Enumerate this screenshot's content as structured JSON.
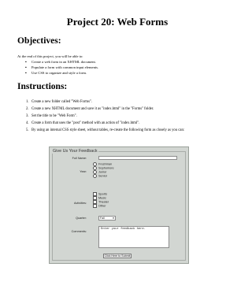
{
  "title": "Project 20: Web Forms",
  "objectives": {
    "heading": "Objectives:",
    "intro": "At the end of this project, you will be able to:",
    "items": [
      "Create a web form in an XHTML document.",
      "Populate a form with common input elements.",
      "Use CSS to organize and style a form."
    ]
  },
  "instructions": {
    "heading": "Instructions:",
    "steps": [
      {
        "num": "1.",
        "text": "Create a new folder called \"Web Forms\"."
      },
      {
        "num": "2.",
        "text": "Create a new XHTML document and save it as \"index.html\" in the \"Forms\" folder."
      },
      {
        "num": "3.",
        "text": "Set the title to be \"Web Form\"."
      },
      {
        "num": "4.",
        "text": "Create a form that uses the \"post\" method with an action of \"index.html\"."
      },
      {
        "num": "5.",
        "text": "By using an internal CSS style sheet, without tables, re-create the following form as closely as you can:"
      }
    ]
  },
  "form": {
    "legend": "Give Us Your Feedback",
    "full_name_label": "Full Name:",
    "year_label": "Year:",
    "year_options": [
      "Freshman",
      "Sophomore",
      "Junior",
      "Senior"
    ],
    "activities_label": "Activities:",
    "activities_options": [
      "Sports",
      "Music",
      "Theater",
      "Other"
    ],
    "quarter_label": "Quarter:",
    "quarter_value": "Fall",
    "comments_label": "Comments:",
    "comments_value": "Enter your feedback here.",
    "submit_label": "Click Here to Submit"
  }
}
